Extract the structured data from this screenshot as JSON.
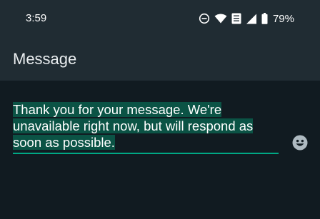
{
  "status_bar": {
    "time": "3:59",
    "battery_percent": "79%",
    "icons": [
      "do-not-disturb-icon",
      "wifi-icon",
      "volte-icon",
      "cellular-signal-icon",
      "battery-icon"
    ]
  },
  "header": {
    "title": "Message"
  },
  "editor": {
    "text": "Thank you for your message. We're unavailable right now, but will respond as soon as possible.",
    "selected": true,
    "accent_color": "#00a884",
    "selection_color": "#0b5345"
  },
  "colors": {
    "background": "#111b21",
    "header_background": "#202c33"
  }
}
